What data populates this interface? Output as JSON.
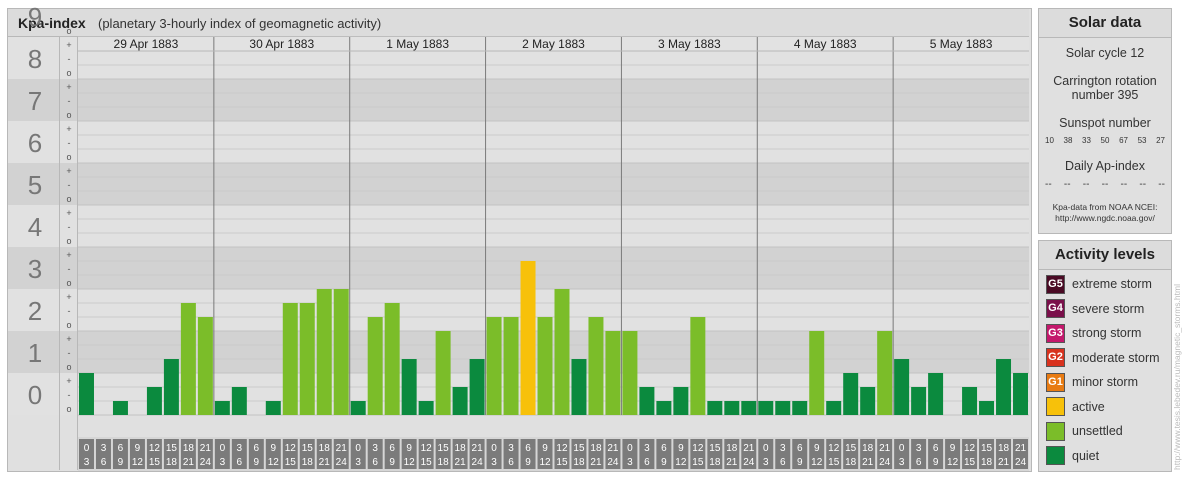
{
  "header": {
    "title": "Kpa-index",
    "subtitle": "(planetary 3-hourly index of geomagnetic activity)"
  },
  "chart_data": {
    "type": "bar",
    "ylim": [
      0,
      9
    ],
    "y_major_ticks": [
      "0",
      "1",
      "2",
      "3",
      "4",
      "5",
      "6",
      "7",
      "8",
      "9"
    ],
    "y_minor_ticks": [
      "o",
      "-",
      "+"
    ],
    "days": [
      "29 Apr 1883",
      "30 Apr 1883",
      "1 May 1883",
      "2 May 1883",
      "3 May 1883",
      "4 May 1883",
      "5 May 1883"
    ],
    "interval_tops": [
      "0",
      "3",
      "6",
      "9",
      "12",
      "15",
      "18",
      "21"
    ],
    "interval_bottoms": [
      "3",
      "6",
      "9",
      "12",
      "15",
      "18",
      "21",
      "24"
    ],
    "values": [
      [
        1.0,
        0.0,
        0.333,
        0.0,
        0.667,
        1.333,
        2.667,
        2.333
      ],
      [
        0.333,
        0.667,
        0.0,
        0.333,
        2.667,
        2.667,
        3.0,
        3.0
      ],
      [
        0.333,
        2.333,
        2.667,
        1.333,
        0.333,
        2.0,
        0.667,
        1.333
      ],
      [
        2.333,
        2.333,
        3.667,
        2.333,
        3.0,
        1.333,
        2.333,
        2.0
      ],
      [
        2.0,
        0.667,
        0.333,
        0.667,
        2.333,
        0.333,
        0.333,
        0.333
      ],
      [
        0.333,
        0.333,
        0.333,
        2.0,
        0.333,
        1.0,
        0.667,
        2.0
      ],
      [
        1.333,
        0.667,
        1.0,
        0.0,
        0.667,
        0.333,
        1.333,
        1.0
      ]
    ],
    "colors": {
      "quiet": "#0b8a3e",
      "unsettled": "#7bbd29",
      "active": "#f7c10a"
    }
  },
  "solar": {
    "title": "Solar data",
    "cycle": "Solar cycle 12",
    "rotation_line1": "Carrington rotation",
    "rotation_line2": "number 395",
    "sunspot_label": "Sunspot number",
    "sunspots": [
      "10",
      "38",
      "33",
      "50",
      "67",
      "53",
      "27"
    ],
    "ap_label": "Daily Ap-index",
    "ap_values": [
      "--",
      "--",
      "--",
      "--",
      "--",
      "--",
      "--"
    ],
    "source_line1": "Kpa-data from NOAA NCEI:",
    "source_line2": "http://www.ngdc.noaa.gov/"
  },
  "activity": {
    "title": "Activity levels",
    "levels": [
      {
        "code": "G5",
        "label": "extreme storm",
        "color": "#4a0a24"
      },
      {
        "code": "G4",
        "label": "severe storm",
        "color": "#7a0f4a"
      },
      {
        "code": "G3",
        "label": "strong storm",
        "color": "#c4186c"
      },
      {
        "code": "G2",
        "label": "moderate storm",
        "color": "#d8321e"
      },
      {
        "code": "G1",
        "label": "minor storm",
        "color": "#e87b12"
      },
      {
        "code": "",
        "label": "active",
        "color": "#f7c10a"
      },
      {
        "code": "",
        "label": "unsettled",
        "color": "#7bbd29"
      },
      {
        "code": "",
        "label": "quiet",
        "color": "#0b8a3e"
      }
    ]
  },
  "watermark": "http://www.tesis.lebedev.ru/magnetic_storms.html"
}
